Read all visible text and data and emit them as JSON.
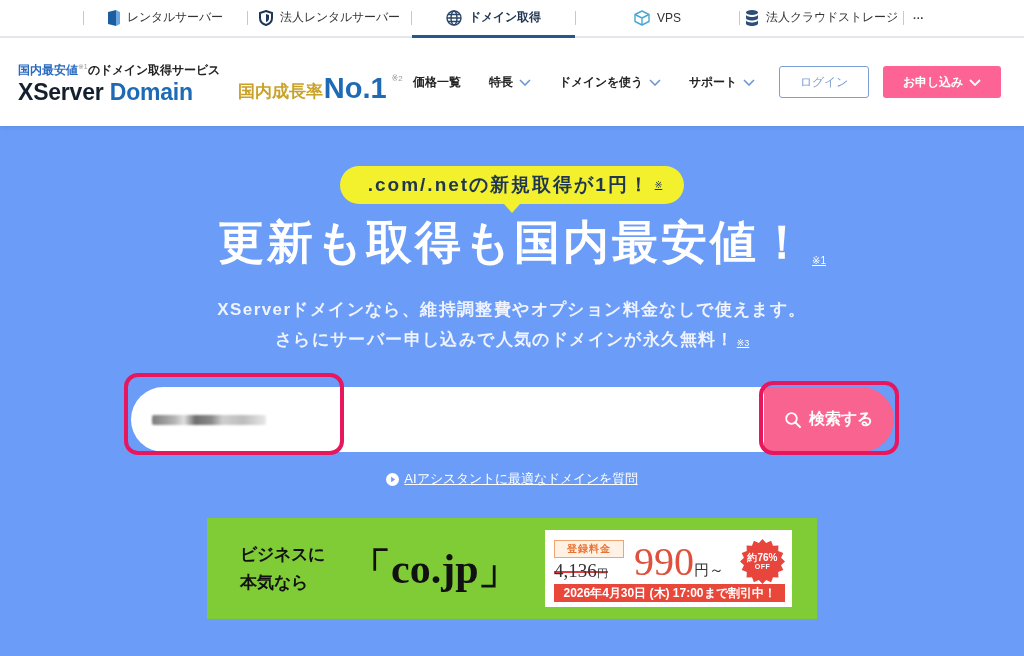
{
  "top_bar": {
    "items": [
      {
        "kind": "server",
        "label": "レンタルサーバー",
        "selected": false
      },
      {
        "kind": "shield",
        "label": "法人レンタルサーバー",
        "selected": false
      },
      {
        "kind": "globe",
        "label": "ドメイン取得",
        "selected": true
      },
      {
        "kind": "cube",
        "label": "VPS",
        "selected": false
      },
      {
        "kind": "database",
        "label": "法人クラウドストレージ",
        "selected": false
      },
      {
        "kind": "more",
        "label": "···",
        "selected": false
      }
    ]
  },
  "header": {
    "tagline": {
      "highlight": "国内最安値",
      "note": "※1",
      "rest": "のドメイン取得サービス"
    },
    "logo": {
      "primary": "XServer",
      "secondary": "Domain"
    },
    "award": {
      "label": "国内成長率",
      "rank": "No.1",
      "note": "※2"
    },
    "nav": [
      {
        "label": "価格一覧",
        "has_menu": false
      },
      {
        "label": "特長",
        "has_menu": true
      },
      {
        "label": "ドメインを使う",
        "has_menu": true
      },
      {
        "label": "サポート",
        "has_menu": true
      }
    ],
    "buttons": [
      {
        "kind": "outline",
        "label": "ログイン",
        "has_menu": false
      },
      {
        "kind": "primary",
        "label": "お申し込み",
        "has_menu": true
      }
    ]
  },
  "hero": {
    "promo": {
      "text": ".com/.netの新規取得が1円！",
      "note": "※"
    },
    "headline": {
      "text": "更新も取得も国内最安値！",
      "note": "※1"
    },
    "subtitle": [
      {
        "text": "XServerドメインなら、維持調整費やオプション料金なしで使えます。"
      },
      {
        "text": "さらにサーバー申し込みで人気のドメインが永久無料！",
        "note": "※3"
      }
    ],
    "search": {
      "field": {
        "value_obscured": true,
        "highlighted": true
      },
      "button": {
        "label": "検索する",
        "highlighted": true
      }
    },
    "ai_link": {
      "label": "AIアシスタントに最適なドメインを質問"
    }
  },
  "banner": {
    "lead": [
      "ビジネスに",
      "本気なら"
    ],
    "domain": "「co.jp」",
    "price_label": "登録料金",
    "old_price": {
      "amount": "4,136",
      "unit": "円",
      "struck": true
    },
    "price": {
      "amount": "990",
      "unit": "円～"
    },
    "badge": [
      "約76%",
      "OFF"
    ],
    "deadline": "2026年4月30日 (木) 17:00まで割引中！"
  }
}
